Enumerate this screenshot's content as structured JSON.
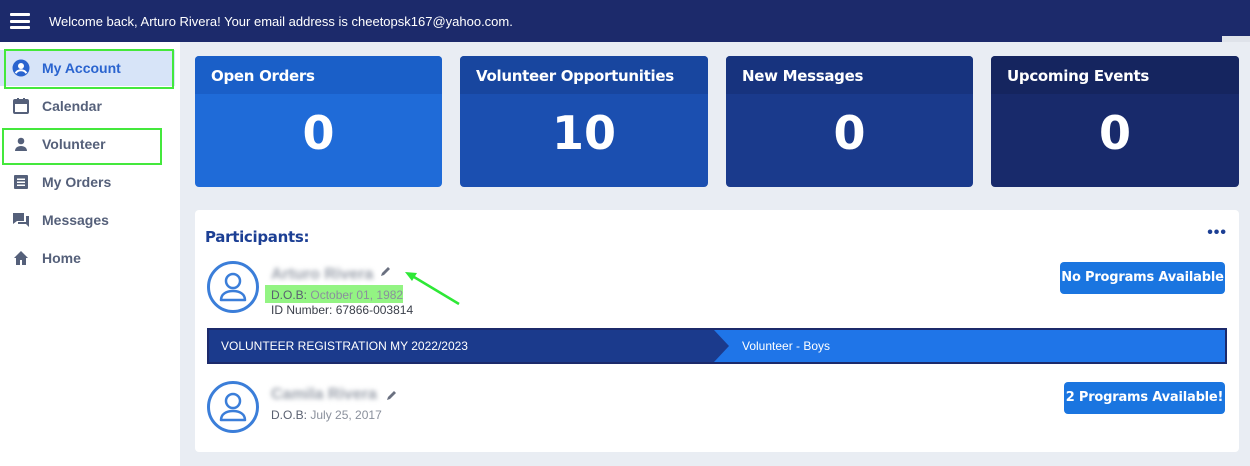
{
  "header": {
    "welcome_text": "Welcome back, Arturo Rivera! Your email address is cheetopsk167@yahoo.com."
  },
  "sidebar": {
    "items": [
      {
        "label": "My Account",
        "icon": "account-circle-icon",
        "active": true
      },
      {
        "label": "Calendar",
        "icon": "calendar-icon"
      },
      {
        "label": "Volunteer",
        "icon": "person-icon"
      },
      {
        "label": "My Orders",
        "icon": "orders-list-icon"
      },
      {
        "label": "Messages",
        "icon": "chat-icon"
      },
      {
        "label": "Home",
        "icon": "home-icon"
      }
    ]
  },
  "stats": [
    {
      "label": "Open Orders",
      "value": "0",
      "color": "#1f6bd8"
    },
    {
      "label": "Volunteer Opportunities",
      "value": "10",
      "color": "#1b4fb0"
    },
    {
      "label": "New Messages",
      "value": "0",
      "color": "#1a3a8c"
    },
    {
      "label": "Upcoming Events",
      "value": "0",
      "color": "#182a6b"
    }
  ],
  "participants": {
    "title": "Participants:",
    "more_label": "•••",
    "people": [
      {
        "name": "Arturo Rivera",
        "dob_label": "D.O.B:",
        "dob_value": "October 01, 1982",
        "id_label": "ID Number:",
        "id_value": "67866-003814",
        "button": "No Programs Available"
      },
      {
        "name": "Camila Rivera",
        "dob_label": "D.O.B:",
        "dob_value": "July 25, 2017",
        "button": "2 Programs Available!"
      }
    ],
    "registration": {
      "program": "VOLUNTEER REGISTRATION MY 2022/2023",
      "role": "Volunteer - Boys"
    }
  },
  "colors": {
    "topbar": "#1c2a6b",
    "highlight": "#44e83c",
    "accent": "#1a75e0"
  }
}
